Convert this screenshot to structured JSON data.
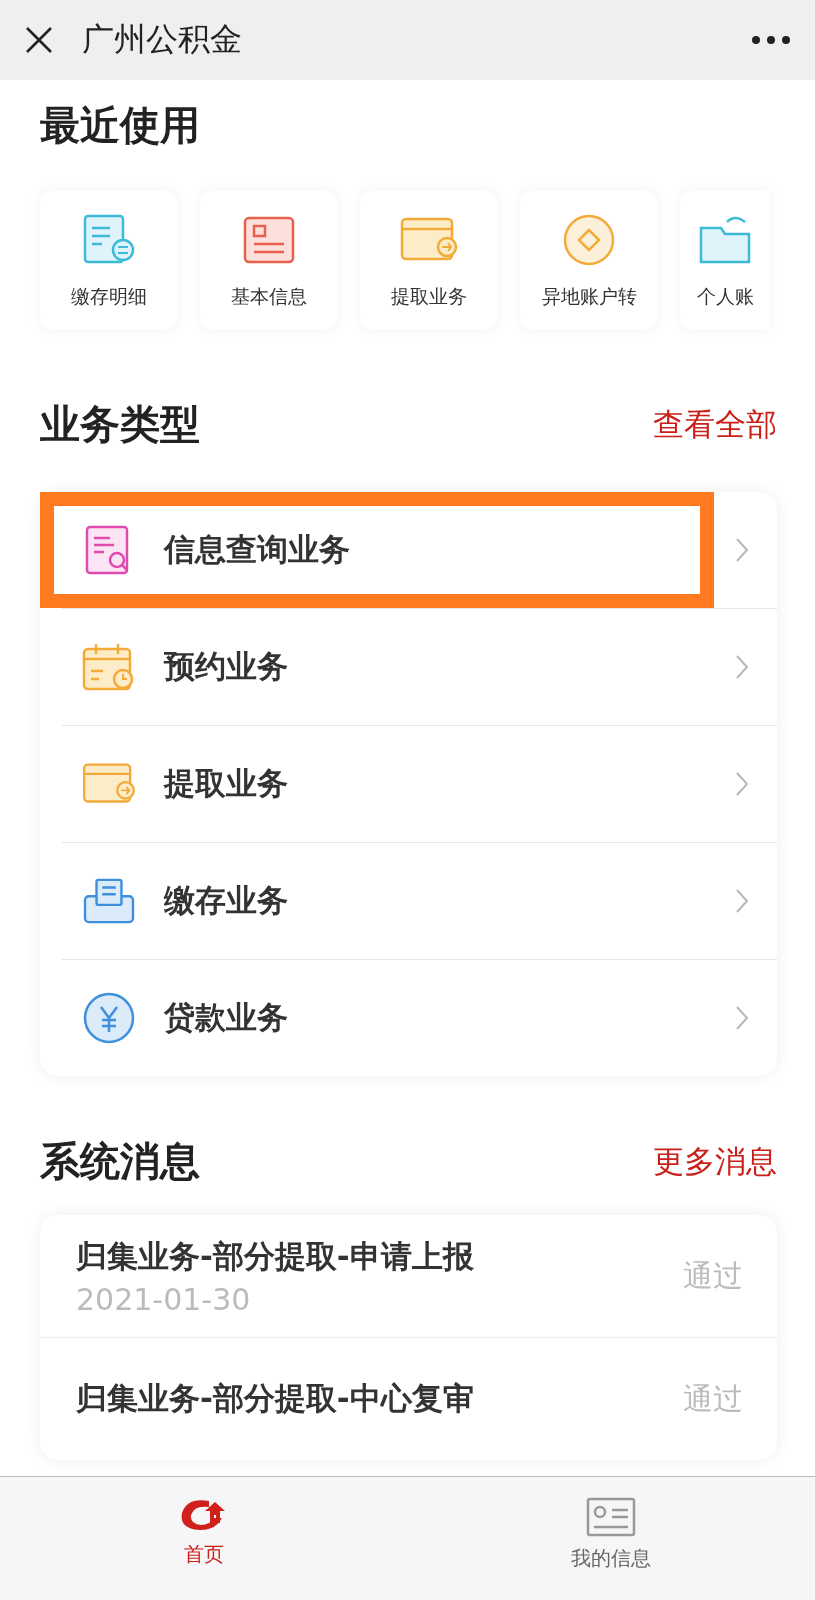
{
  "window": {
    "title": "广州公积金"
  },
  "recent": {
    "title": "最近使用",
    "items": [
      {
        "label": "缴存明细"
      },
      {
        "label": "基本信息"
      },
      {
        "label": "提取业务"
      },
      {
        "label": "异地账户转"
      },
      {
        "label": "个人账"
      }
    ]
  },
  "business": {
    "title": "业务类型",
    "link": "查看全部",
    "items": [
      {
        "label": "信息查询业务",
        "highlighted": true
      },
      {
        "label": "预约业务",
        "highlighted": false
      },
      {
        "label": "提取业务",
        "highlighted": false
      },
      {
        "label": "缴存业务",
        "highlighted": false
      },
      {
        "label": "贷款业务",
        "highlighted": false
      }
    ]
  },
  "messages": {
    "title": "系统消息",
    "link": "更多消息",
    "items": [
      {
        "title": "归集业务-部分提取-申请上报",
        "date": "2021-01-30",
        "status": "通过"
      },
      {
        "title": "归集业务-部分提取-中心复审",
        "status": "通过"
      }
    ]
  },
  "tab_bar": [
    {
      "label": "首页",
      "selected": true
    },
    {
      "label": "我的信息",
      "selected": false
    }
  ]
}
